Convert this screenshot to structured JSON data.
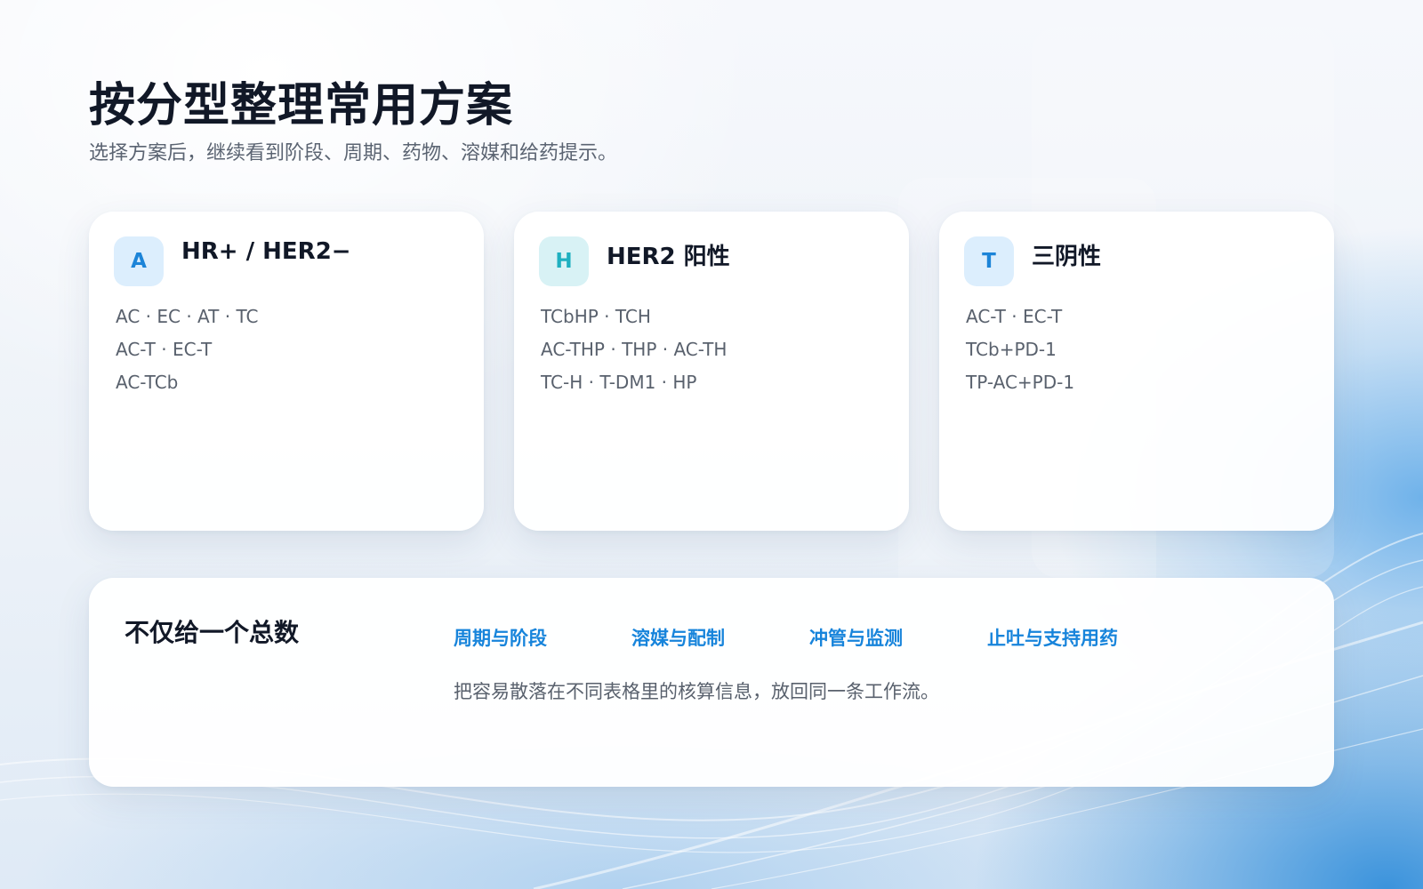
{
  "page": {
    "title": "按分型整理常用方案",
    "subtitle": "选择方案后，继续看到阶段、周期、药物、溶媒和给药提示。"
  },
  "cards": [
    {
      "badge": "A",
      "title": "HR+ / HER2−",
      "lines": [
        "AC · EC · AT · TC",
        "AC-T · EC-T",
        "AC-TCb"
      ]
    },
    {
      "badge": "H",
      "title": "HER2 阳性",
      "lines": [
        "TCbHP · TCH",
        "AC-THP · THP · AC-TH",
        "TC-H · T-DM1 · HP"
      ]
    },
    {
      "badge": "T",
      "title": "三阴性",
      "lines": [
        "AC-T · EC-T",
        "TCb+PD-1",
        "TP-AC+PD-1"
      ]
    }
  ],
  "panel": {
    "title": "不仅给一个总数",
    "links": [
      "周期与阶段",
      "溶媒与配制",
      "冲管与监测",
      "止吐与支持用药"
    ],
    "description": "把容易散落在不同表格里的核算信息，放回同一条工作流。"
  },
  "colors": {
    "accent": "#1784db",
    "badge_blue_bg": "#dceefd",
    "badge_blue_fg": "#1c84d8",
    "badge_teal_bg": "#d8f2f5",
    "badge_teal_fg": "#1fb0c0"
  }
}
